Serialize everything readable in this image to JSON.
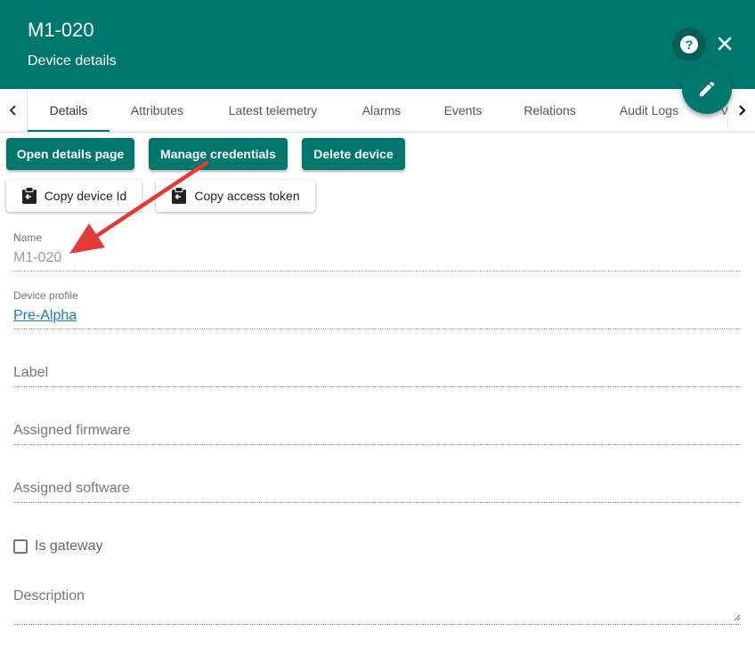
{
  "header": {
    "title": "M1-020",
    "subtitle": "Device details",
    "help_glyph": "?",
    "icons": {
      "help": "help-icon",
      "close": "close-icon",
      "edit": "pencil-icon"
    }
  },
  "tabs": {
    "items": [
      {
        "label": "Details",
        "active": true
      },
      {
        "label": "Attributes"
      },
      {
        "label": "Latest telemetry"
      },
      {
        "label": "Alarms"
      },
      {
        "label": "Events"
      },
      {
        "label": "Relations"
      },
      {
        "label": "Audit Logs"
      },
      {
        "label": "V"
      }
    ],
    "scroll_icons": [
      "chevron-left-icon",
      "chevron-right-icon"
    ]
  },
  "actions": {
    "open_details": "Open details page",
    "manage_credentials": "Manage credentials",
    "delete_device": "Delete device",
    "copy_device_id": "Copy device Id",
    "copy_access_token": "Copy access token"
  },
  "form": {
    "name": {
      "label": "Name",
      "value": "M1-020"
    },
    "device_profile": {
      "label": "Device profile",
      "value": "Pre-Alpha"
    },
    "label": {
      "placeholder": "Label"
    },
    "assigned_firmware": {
      "placeholder": "Assigned firmware"
    },
    "assigned_software": {
      "placeholder": "Assigned software"
    },
    "is_gateway": {
      "label": "Is gateway",
      "checked": false
    },
    "description": {
      "placeholder": "Description"
    }
  },
  "colors": {
    "primary": "#00776d",
    "link": "#1976d2",
    "annotation_arrow": "#e53935"
  }
}
